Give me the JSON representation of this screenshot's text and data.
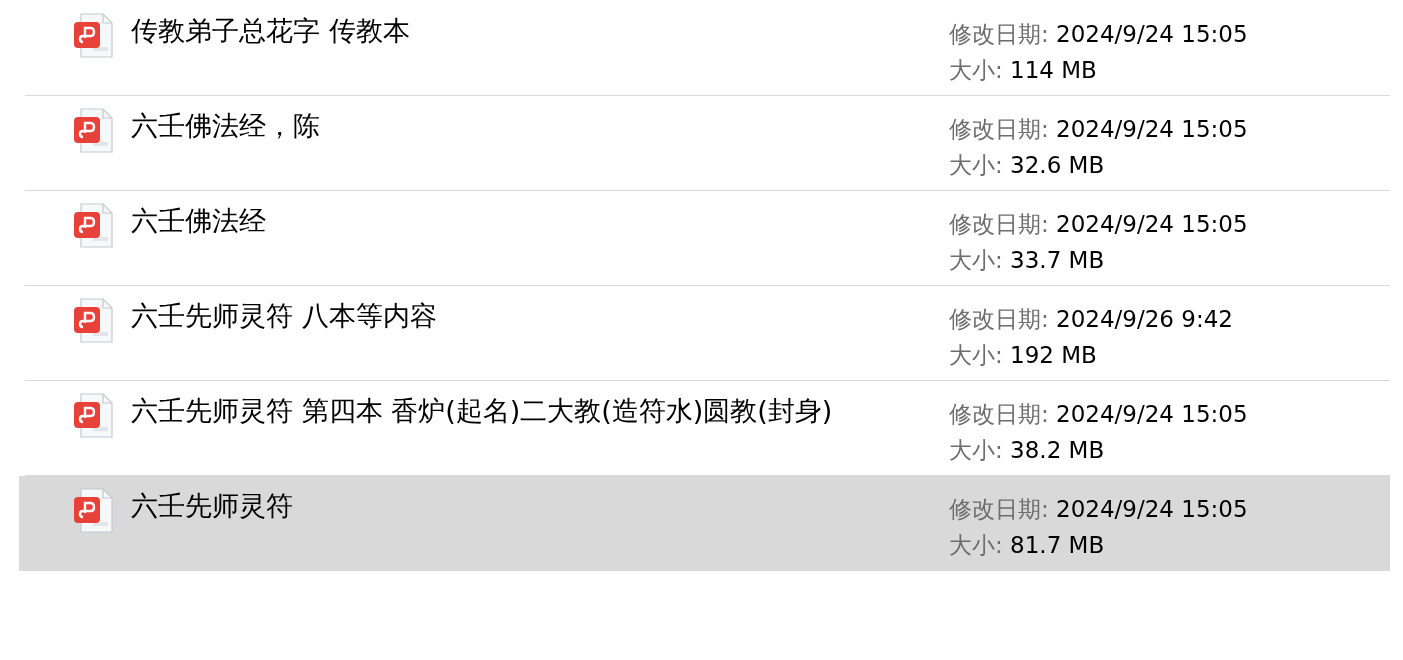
{
  "files": [
    {
      "name": "传教弟子总花字 传教本",
      "modified_label": "修改日期:",
      "modified": "2024/9/24 15:05",
      "size_label": "大小:",
      "size": "114 MB",
      "selected": false
    },
    {
      "name": "六壬佛法经，陈",
      "modified_label": "修改日期:",
      "modified": "2024/9/24 15:05",
      "size_label": "大小:",
      "size": "32.6 MB",
      "selected": false
    },
    {
      "name": "六壬佛法经",
      "modified_label": "修改日期:",
      "modified": "2024/9/24 15:05",
      "size_label": "大小:",
      "size": "33.7 MB",
      "selected": false
    },
    {
      "name": "六壬先师灵符 八本等内容",
      "modified_label": "修改日期:",
      "modified": "2024/9/26 9:42",
      "size_label": "大小:",
      "size": "192 MB",
      "selected": false
    },
    {
      "name": "六壬先师灵符 第四本 香炉(起名)二大教(造符水)圆教(封身)",
      "modified_label": "修改日期:",
      "modified": "2024/9/24 15:05",
      "size_label": "大小:",
      "size": "38.2 MB",
      "selected": false
    },
    {
      "name": "六壬先师灵符",
      "modified_label": "修改日期:",
      "modified": "2024/9/24 15:05",
      "size_label": "大小:",
      "size": "81.7 MB",
      "selected": true
    }
  ]
}
